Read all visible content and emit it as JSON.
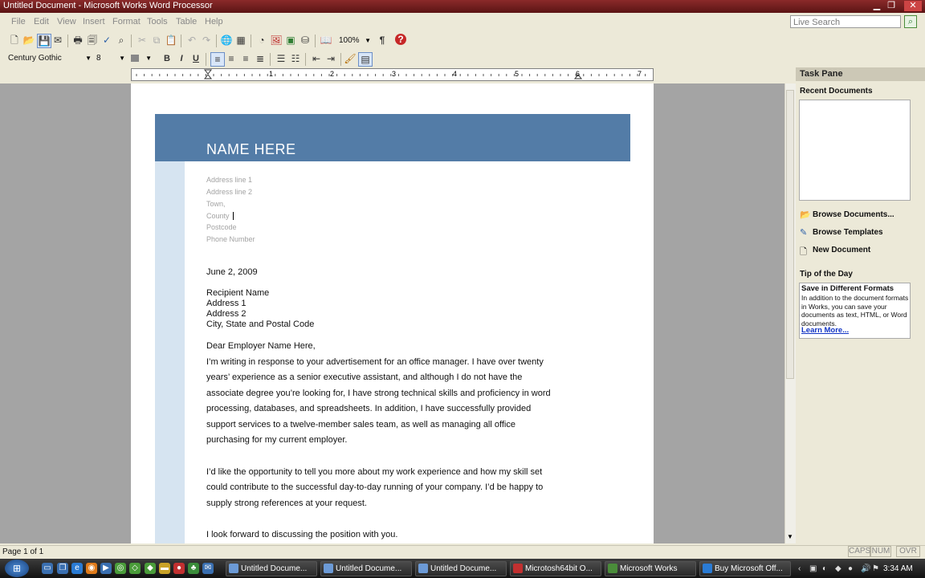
{
  "window": {
    "title": "Untitled Document - Microsoft Works Word Processor"
  },
  "menu": {
    "items": [
      "File",
      "Edit",
      "View",
      "Insert",
      "Format",
      "Tools",
      "Table",
      "Help"
    ]
  },
  "search": {
    "placeholder": "Live Search"
  },
  "toolbar": {
    "font": "Century Gothic",
    "size": "8",
    "zoom": "100%",
    "bold": "B",
    "italic": "I",
    "underline": "U",
    "pilcrow": "¶"
  },
  "ruler": {
    "labels": [
      "1",
      "2",
      "3",
      "4",
      "5",
      "6",
      "7"
    ]
  },
  "document": {
    "name": "NAME HERE",
    "address_lines": [
      "Address line 1",
      "Address line 2",
      "Town,",
      "County",
      "Postcode",
      "Phone Number"
    ],
    "date": "June 2, 2009",
    "recipient": [
      "Recipient Name",
      "Address 1",
      "Address 2",
      "City, State and Postal Code"
    ],
    "salutation": "Dear Employer Name Here,",
    "paragraph1": [
      "I’m writing in response to your advertisement for an office manager. I have over twenty",
      "years’ experience as a senior executive assistant, and although I do not have the",
      "associate degree you’re looking for, I have strong technical skills and proficiency in word",
      "processing, databases, and spreadsheets. In addition, I have successfully provided",
      "support services to a twelve-member sales team, as well as managing all office",
      "purchasing for my current employer."
    ],
    "paragraph2": [
      "I’d like the opportunity to tell you more about my work experience and how my skill set",
      "could contribute to the successful day-to-day running of your company. I’d be happy to",
      "supply strong references at your request."
    ],
    "paragraph3": "I look forward to discussing the position with you."
  },
  "taskpane": {
    "title": "Task Pane",
    "recent_label": "Recent Documents",
    "links": [
      "Browse Documents...",
      "Browse Templates",
      "New Document"
    ],
    "tip_label": "Tip of the Day",
    "tip_title": "Save in Different Formats",
    "tip_body": "In addition to the document formats in Works, you can save your documents as text, HTML, or Word documents.",
    "tip_link": "Learn More..."
  },
  "status": {
    "page": "Page 1 of 1",
    "indicators": [
      "CAPS",
      "NUM",
      "OVR"
    ]
  },
  "taskbar": {
    "tasks": [
      "Untitled Docume...",
      "Untitled Docume...",
      "Untitled Docume...",
      "Microtosh64bit O...",
      "Microsoft Works",
      "Buy Microsoft Off..."
    ],
    "clock": "3:34 AM"
  }
}
